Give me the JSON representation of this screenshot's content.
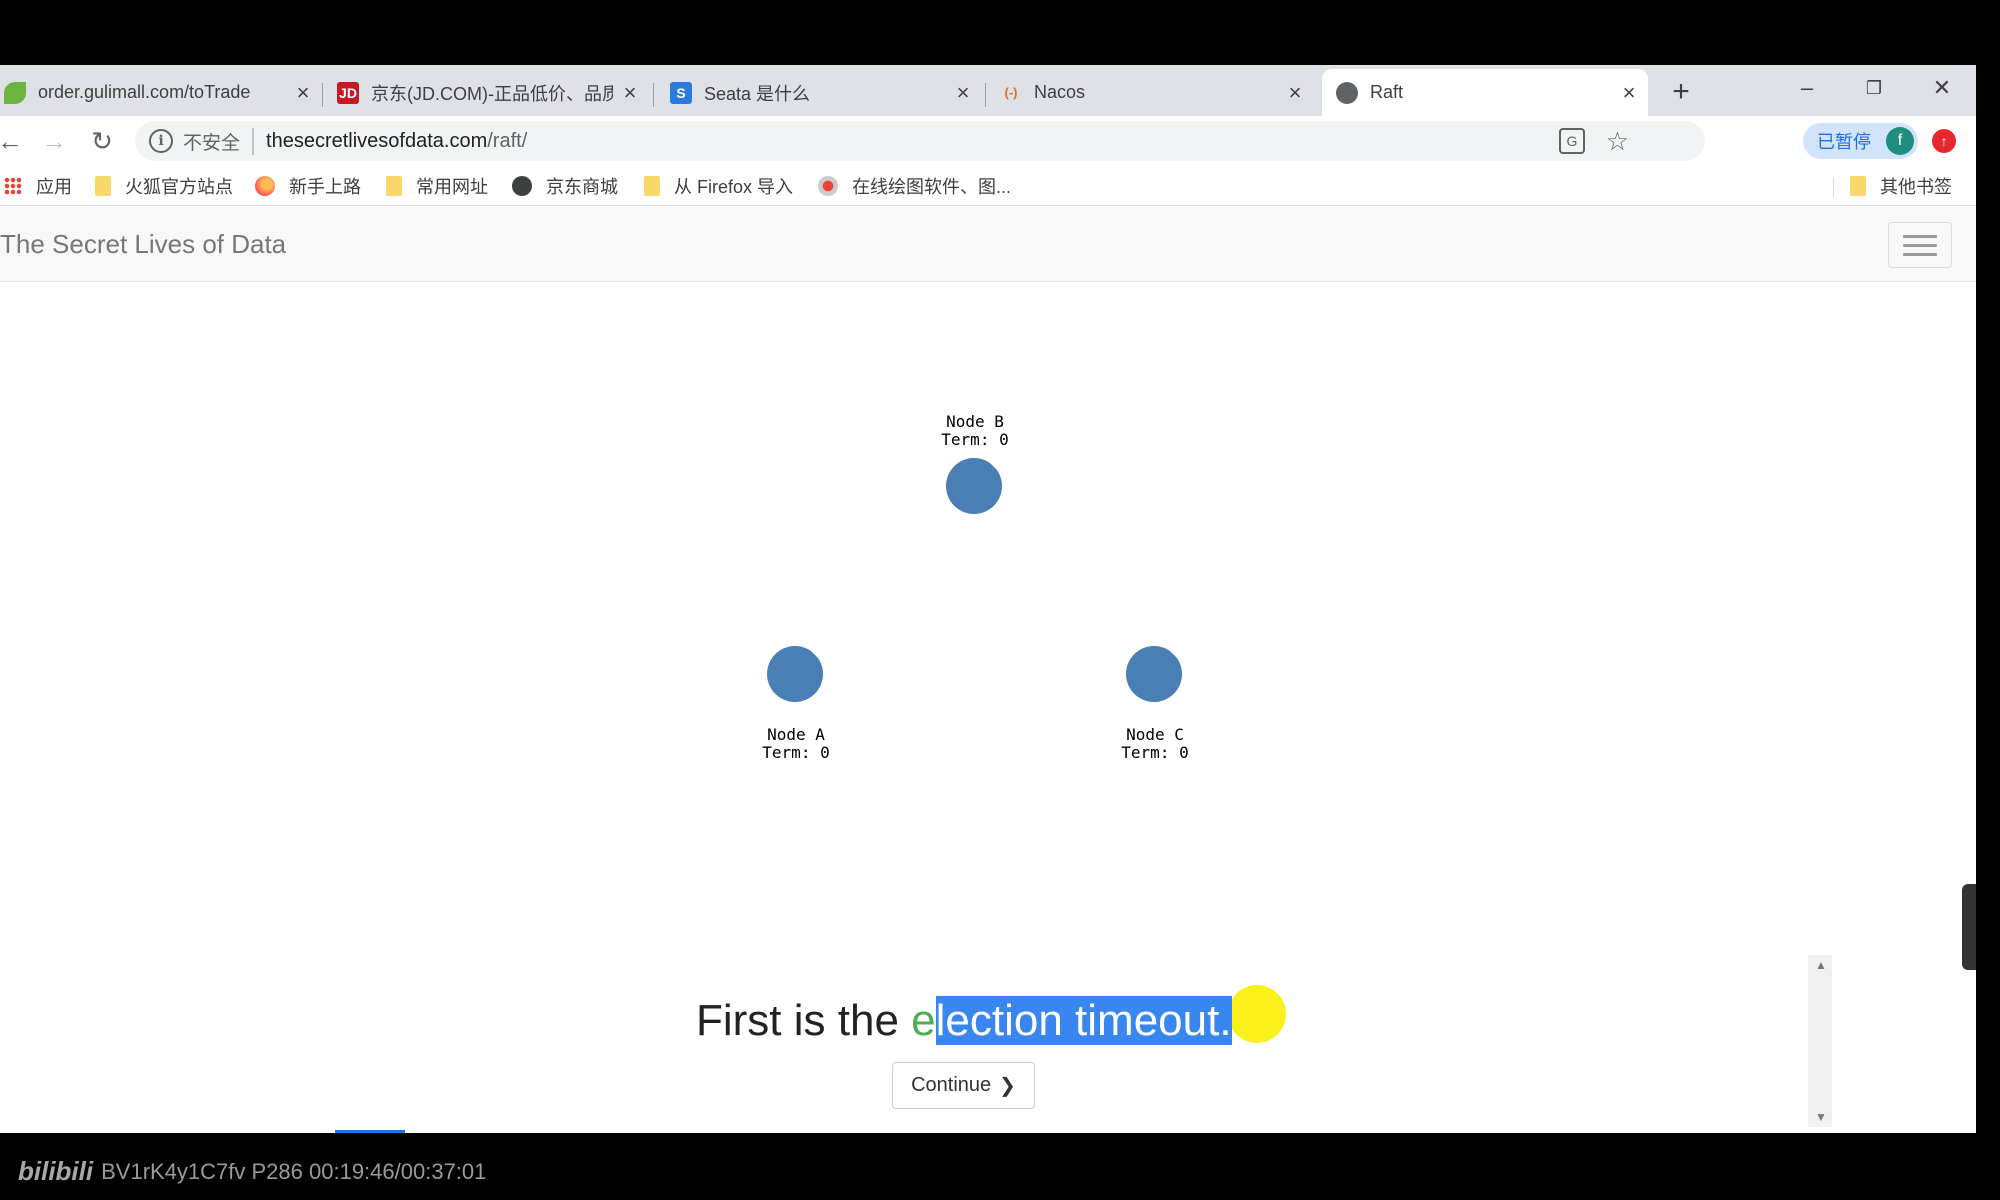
{
  "browser": {
    "tabs": [
      {
        "title": "order.gulimall.com/toTrade",
        "favicon": "spring-leaf-icon"
      },
      {
        "title": "京东(JD.COM)-正品低价、品质",
        "favicon": "jd-logo-icon",
        "favicon_text": "JD"
      },
      {
        "title": "Seata 是什么",
        "favicon": "seata-s-icon",
        "favicon_text": "S"
      },
      {
        "title": "Nacos",
        "favicon": "nacos-bracket-icon",
        "favicon_text": "(-)"
      },
      {
        "title": "Raft",
        "favicon": "globe-icon",
        "active": true
      }
    ],
    "newtab_label": "+",
    "window_controls": {
      "minimize": "–",
      "restore": "❐",
      "close": "✕"
    },
    "toolbar": {
      "back": "←",
      "forward": "→",
      "reload": "↻",
      "security_label": "不安全",
      "url_host": "thesecretlivesofdata.com",
      "url_path": "/raft/",
      "profile_status": "已暂停",
      "profile_initial": "f"
    },
    "bookmarks": [
      {
        "label": "应用",
        "icon": "apps-grid-icon"
      },
      {
        "label": "火狐官方站点",
        "icon": "folder-icon"
      },
      {
        "label": "新手上路",
        "icon": "firefox-icon"
      },
      {
        "label": "常用网址",
        "icon": "folder-icon"
      },
      {
        "label": "京东商城",
        "icon": "globe-icon"
      },
      {
        "label": "从 Firefox 导入",
        "icon": "folder-icon"
      },
      {
        "label": "在线绘图软件、图...",
        "icon": "drawio-icon"
      }
    ],
    "other_bookmarks": "其他书签"
  },
  "page": {
    "brand": "The Secret Lives of Data",
    "nodes": [
      {
        "name": "Node B",
        "term": "Term: 0"
      },
      {
        "name": "Node A",
        "term": "Term: 0"
      },
      {
        "name": "Node C",
        "term": "Term: 0"
      }
    ],
    "caption": {
      "prefix": "First is the ",
      "green_part": "e",
      "selected_part": "lection timeout."
    },
    "continue_label": "Continue"
  },
  "overlay": {
    "watermark_logo": "bilibili",
    "watermark_text": "BV1rK4y1C7fv P286 00:19:46/00:37:01"
  },
  "colors": {
    "node_fill": "#4a7fb5",
    "selection": "#3a86f0",
    "highlight_green": "#4caf50",
    "cursor_highlight": "#f8f000"
  }
}
